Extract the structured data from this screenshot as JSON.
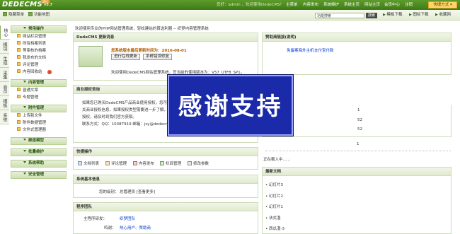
{
  "topbar": {
    "logo": "DEDECMS",
    "version": "v5.7",
    "badge": "SP1",
    "greeting_prefix": "您好：admin ，欢迎使用DedeCMS！",
    "nav": [
      "主菜单",
      "内容发布",
      "系统维护",
      "系统主页",
      "网站主页",
      "会员中心",
      "注销"
    ],
    "quick_menu": "快捷方式 ▾"
  },
  "bar2": {
    "hide_menu": "隐藏菜单",
    "function_map": "功能地图",
    "search_placeholder": "功能搜索",
    "search_button": "搜索",
    "module_download": "模板下载",
    "plugin_download": "图标下载",
    "fav_link": "收藏网"
  },
  "vtabs": [
    "核心",
    "模块",
    "生成",
    "采集",
    "会员",
    "模板",
    "系统"
  ],
  "sidebar": {
    "groups": [
      {
        "title": "常用操作",
        "items": [
          "网站栏目管理",
          "所有档案列表",
          "等审核的档案",
          "我发布的文档",
          "评论管理",
          "内容回收站"
        ]
      },
      {
        "title": "内容管理",
        "items": [
          "普通文章",
          "专题管理"
        ]
      },
      {
        "title": "附件管理",
        "items": [
          "上传新文件",
          "附件数据管理",
          "文件式管理器"
        ]
      },
      {
        "title": "频道模型",
        "items": []
      },
      {
        "title": "批量维护",
        "items": []
      },
      {
        "title": "系统帮助",
        "items": []
      },
      {
        "title": "安全管理",
        "items": []
      }
    ]
  },
  "main": {
    "welcome": "欢迎使用专业的PHP网站管理系统，轻松建站的首选利器 -- 织梦内容管理系统",
    "update_panel": {
      "title": "DedeCMS 更新消息",
      "latest": "您系统版本最后更新时间为：2016-08-01",
      "btn_update": "进行在线更新",
      "btn_check": "系统错误修复",
      "version_note": "欢迎使用DedeCMS网站管理系统，您当前的使用版本为：V57_UTF8_SP1。"
    },
    "auth_panel": {
      "title": "商业授权咨询",
      "lines": [
        "如果您已购买DedeCMS产品商业使用授权，您可以",
        "关商业授权信息，如果授权类型需要进一步了解，期...",
        "授权，请及时到我们官方获取。",
        "联系方式：QQ：10387919 邮箱：jsy@dedecms.c..."
      ]
    },
    "quick_panel": {
      "title": "快捷操作",
      "items": [
        "文档列表",
        "评论管理",
        "内容发布",
        "栏目管理",
        "修改参数"
      ]
    },
    "sysinfo_panel": {
      "title": "系统基本信息",
      "level_label": "您的级别：",
      "level_value": "总管理员 [查看更多]"
    },
    "team_panel": {
      "title": "程序团队",
      "rows": [
        {
          "label": "主程序研发：",
          "value": "织梦团队"
        },
        {
          "label": "鸣谢：",
          "value": "热心用户、赞助商"
        }
      ]
    }
  },
  "right": {
    "sponsor_panel": {
      "title": "赞助商链接(说明)",
      "links": [
        "免备案海外主机",
        "支付宝付款"
      ]
    },
    "stats": [
      "1",
      "52",
      "52",
      "1"
    ],
    "loading_text": "正在载入中......",
    "latest_panel": {
      "title": "最新文档",
      "items": [
        "幻灯片3",
        "幻灯片2",
        "幻灯片1",
        "法式湿",
        "西瓜湿-3"
      ]
    }
  },
  "overlay": {
    "text": "感谢支持"
  }
}
